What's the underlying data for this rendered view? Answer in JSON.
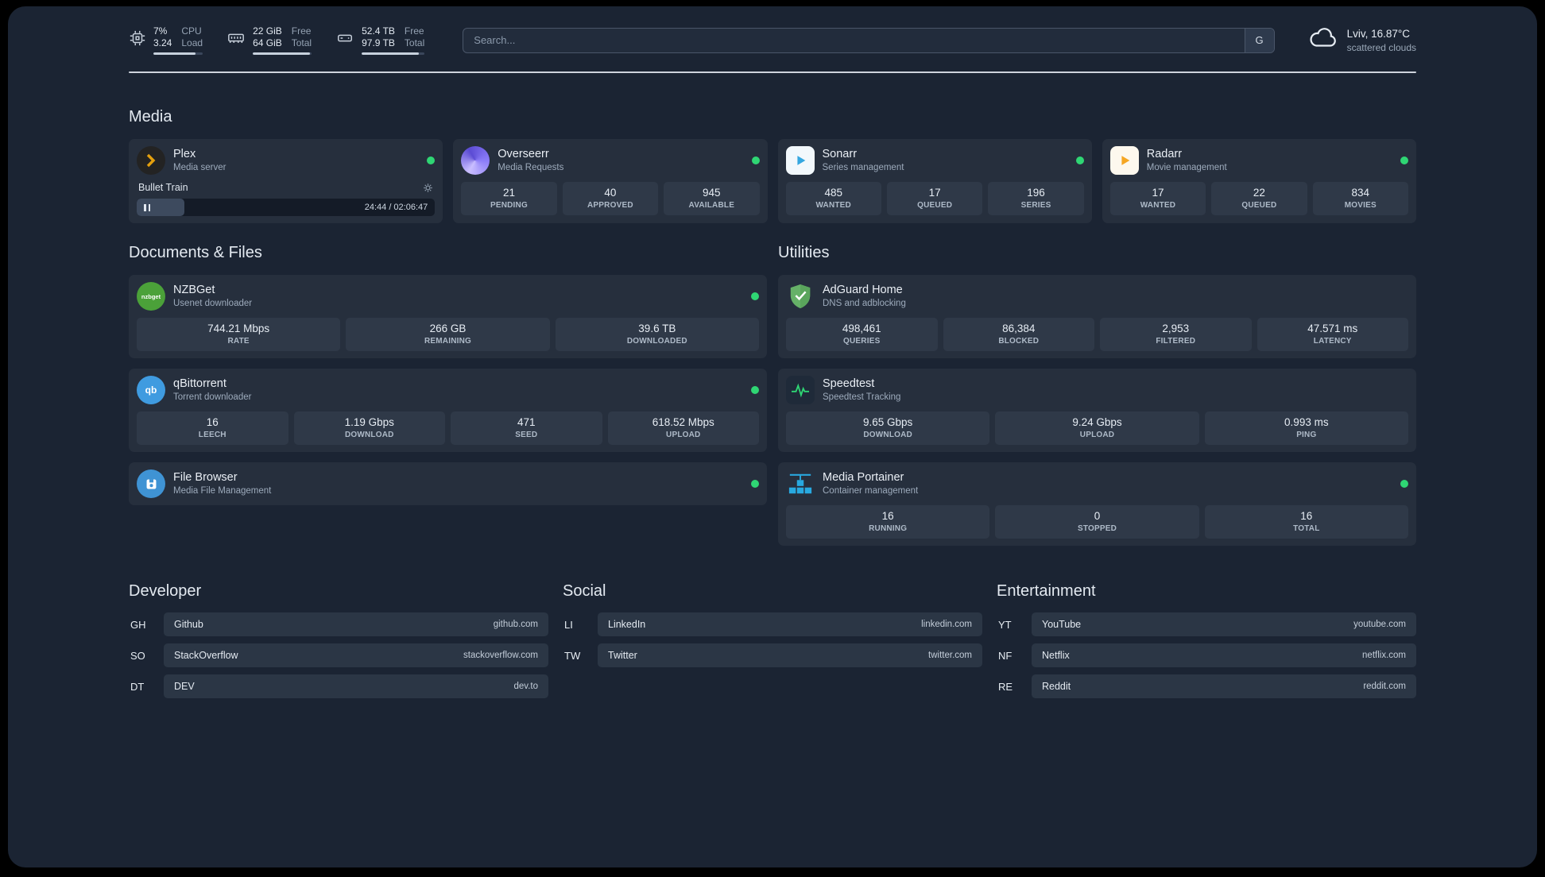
{
  "topbar": {
    "cpu": {
      "value_top": "7%",
      "value_bottom": "3.24",
      "label_top": "CPU",
      "label_bottom": "Load"
    },
    "ram": {
      "value_top": "22 GiB",
      "value_bottom": "64 GiB",
      "label_top": "Free",
      "label_bottom": "Total"
    },
    "disk": {
      "value_top": "52.4 TB",
      "value_bottom": "97.9 TB",
      "label_top": "Free",
      "label_bottom": "Total"
    },
    "search": {
      "placeholder": "Search...",
      "provider": "G"
    },
    "weather": {
      "location": "Lviv, 16.87°C",
      "condition": "scattered clouds"
    }
  },
  "media": {
    "heading": "Media",
    "plex": {
      "title": "Plex",
      "subtitle": "Media server",
      "now_playing": "Bullet Train",
      "time": "24:44 / 02:06:47"
    },
    "overseerr": {
      "title": "Overseerr",
      "subtitle": "Media Requests",
      "stats": [
        {
          "value": "21",
          "label": "PENDING"
        },
        {
          "value": "40",
          "label": "APPROVED"
        },
        {
          "value": "945",
          "label": "AVAILABLE"
        }
      ]
    },
    "sonarr": {
      "title": "Sonarr",
      "subtitle": "Series management",
      "stats": [
        {
          "value": "485",
          "label": "WANTED"
        },
        {
          "value": "17",
          "label": "QUEUED"
        },
        {
          "value": "196",
          "label": "SERIES"
        }
      ]
    },
    "radarr": {
      "title": "Radarr",
      "subtitle": "Movie management",
      "stats": [
        {
          "value": "17",
          "label": "WANTED"
        },
        {
          "value": "22",
          "label": "QUEUED"
        },
        {
          "value": "834",
          "label": "MOVIES"
        }
      ]
    }
  },
  "documents": {
    "heading": "Documents & Files",
    "nzbget": {
      "title": "NZBGet",
      "subtitle": "Usenet downloader",
      "icon_text": "nzbget",
      "stats": [
        {
          "value": "744.21 Mbps",
          "label": "RATE"
        },
        {
          "value": "266 GB",
          "label": "REMAINING"
        },
        {
          "value": "39.6 TB",
          "label": "DOWNLOADED"
        }
      ]
    },
    "qbittorrent": {
      "title": "qBittorrent",
      "subtitle": "Torrent downloader",
      "icon_text": "qb",
      "stats": [
        {
          "value": "16",
          "label": "LEECH"
        },
        {
          "value": "1.19 Gbps",
          "label": "DOWNLOAD"
        },
        {
          "value": "471",
          "label": "SEED"
        },
        {
          "value": "618.52 Mbps",
          "label": "UPLOAD"
        }
      ]
    },
    "filebrowser": {
      "title": "File Browser",
      "subtitle": "Media File Management"
    }
  },
  "utilities": {
    "heading": "Utilities",
    "adguard": {
      "title": "AdGuard Home",
      "subtitle": "DNS and adblocking",
      "stats": [
        {
          "value": "498,461",
          "label": "QUERIES"
        },
        {
          "value": "86,384",
          "label": "BLOCKED"
        },
        {
          "value": "2,953",
          "label": "FILTERED"
        },
        {
          "value": "47.571 ms",
          "label": "LATENCY"
        }
      ]
    },
    "speedtest": {
      "title": "Speedtest",
      "subtitle": "Speedtest Tracking",
      "stats": [
        {
          "value": "9.65 Gbps",
          "label": "DOWNLOAD"
        },
        {
          "value": "9.24 Gbps",
          "label": "UPLOAD"
        },
        {
          "value": "0.993 ms",
          "label": "PING"
        }
      ]
    },
    "portainer": {
      "title": "Media Portainer",
      "subtitle": "Container management",
      "stats": [
        {
          "value": "16",
          "label": "RUNNING"
        },
        {
          "value": "0",
          "label": "STOPPED"
        },
        {
          "value": "16",
          "label": "TOTAL"
        }
      ]
    }
  },
  "bookmarks": [
    {
      "heading": "Developer",
      "items": [
        {
          "abbr": "GH",
          "name": "Github",
          "url": "github.com"
        },
        {
          "abbr": "SO",
          "name": "StackOverflow",
          "url": "stackoverflow.com"
        },
        {
          "abbr": "DT",
          "name": "DEV",
          "url": "dev.to"
        }
      ]
    },
    {
      "heading": "Social",
      "items": [
        {
          "abbr": "LI",
          "name": "LinkedIn",
          "url": "linkedin.com"
        },
        {
          "abbr": "TW",
          "name": "Twitter",
          "url": "twitter.com"
        }
      ]
    },
    {
      "heading": "Entertainment",
      "items": [
        {
          "abbr": "YT",
          "name": "YouTube",
          "url": "youtube.com"
        },
        {
          "abbr": "NF",
          "name": "Netflix",
          "url": "netflix.com"
        },
        {
          "abbr": "RE",
          "name": "Reddit",
          "url": "reddit.com"
        }
      ]
    }
  ],
  "colors": {
    "accent_green": "#2fd674",
    "background": "#1b2433",
    "card": "#262f3d"
  }
}
